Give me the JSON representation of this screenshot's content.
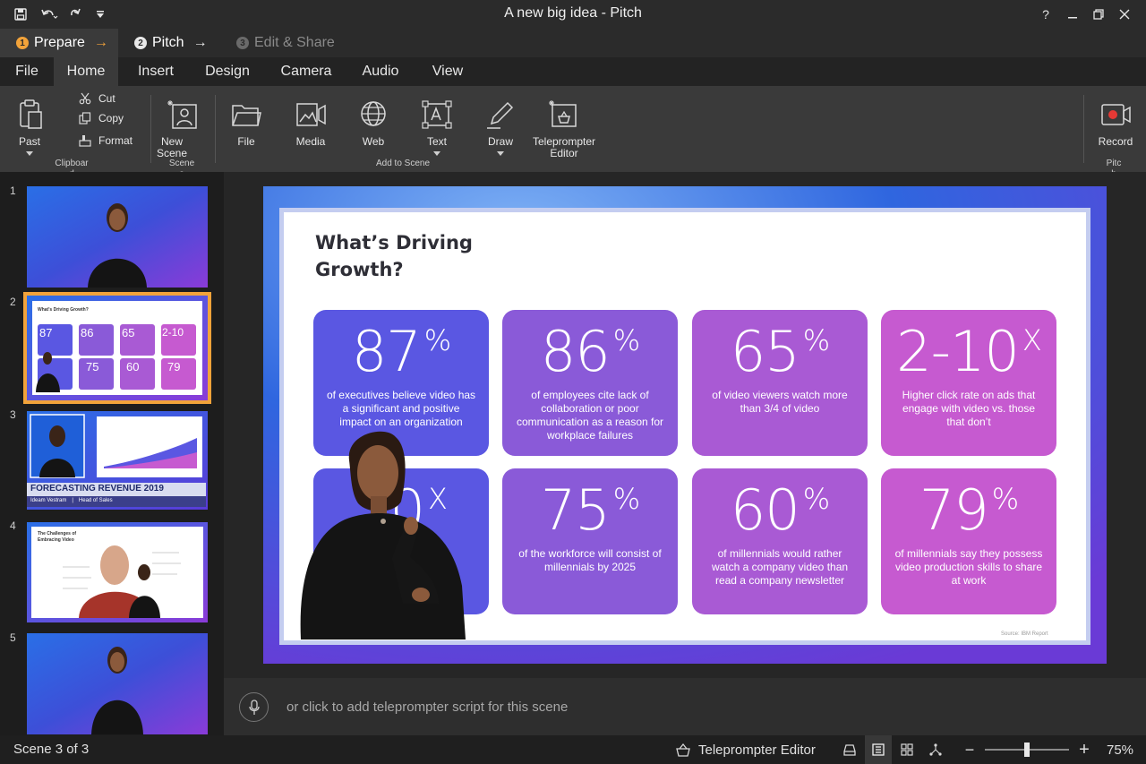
{
  "window": {
    "title": "A new big idea - Pitch",
    "help": "?"
  },
  "steps": [
    {
      "num": "1",
      "label": "Prepare",
      "arrow": "→"
    },
    {
      "num": "2",
      "label": "Pitch",
      "arrow": "→"
    },
    {
      "num": "3",
      "label": "Edit & Share"
    }
  ],
  "menu": [
    "File",
    "Home",
    "Insert",
    "Design",
    "Camera",
    "Audio",
    "View"
  ],
  "ribbon": {
    "paste": "Past",
    "cut": "Cut",
    "copy": "Copy",
    "format": "Format",
    "clipboard_group": "Clipboar",
    "clipboard_group_wrap": "d",
    "new_scene_1": "New",
    "new_scene_2": "Scene",
    "scene_group": "Scene",
    "scene_group_wrap": "s",
    "file": "File",
    "media": "Media",
    "web": "Web",
    "text": "Text",
    "draw": "Draw",
    "tele_1": "Teleprompter",
    "tele_2": "Editor",
    "add_group": "Add to Scene",
    "record": "Record",
    "pitch_group": "Pitc",
    "pitch_group_wrap": "h"
  },
  "scenes": {
    "numbers": [
      "1",
      "2",
      "3",
      "4",
      "5"
    ],
    "thumb2_title": "What's Driving Growth?",
    "thumb2_stats": [
      "87",
      "86",
      "65",
      "2-10",
      "75",
      "60",
      "79"
    ],
    "thumb3_banner": "FORECASTING REVENUE 2019",
    "thumb3_name": "Ideam Vestram",
    "thumb3_sep": "|",
    "thumb3_role": "Head of Sales",
    "thumb4_title": "The Challenges of Embracing Video"
  },
  "slide": {
    "title": "What’s Driving Growth?",
    "source": "Source: IBM Report",
    "stats": [
      {
        "value": "87",
        "sup": "%",
        "desc": "of executives believe video has a significant and positive impact on an organization",
        "color": "#5a57e2"
      },
      {
        "value": "86",
        "sup": "%",
        "desc": "of employees cite lack of collaboration or poor communication as a reason for workplace failures",
        "color": "#8a5ad8"
      },
      {
        "value": "65",
        "sup": "%",
        "desc": "of video viewers watch more than 3/4 of video",
        "color": "#a95ad4"
      },
      {
        "value": "2-10",
        "sup": "X",
        "desc": "Higher click rate on ads that engage with video vs. those that don’t",
        "color": "#c65ad0"
      },
      {
        "value": "10",
        "sup": "X",
        "desc": "",
        "color": "#5a57e2"
      },
      {
        "value": "75",
        "sup": "%",
        "desc": "of the workforce will consist of millennials by 2025",
        "color": "#8a5ad8"
      },
      {
        "value": "60",
        "sup": "%",
        "desc": "of millennials would rather watch a company video than read a company newsletter",
        "color": "#a95ad4"
      },
      {
        "value": "79",
        "sup": "%",
        "desc": "of millennials say they possess video production skills to share at work",
        "color": "#c65ad0"
      }
    ]
  },
  "teleprompter": {
    "placeholder": "or click to add teleprompter script for this scene"
  },
  "status": {
    "scene": "Scene 3 of 3",
    "tele_editor": "Teleprompter Editor",
    "zoom": "75%",
    "minus": "−",
    "plus": "+"
  },
  "colors": {
    "accent": "#f2a33a",
    "record": "#e53935"
  }
}
